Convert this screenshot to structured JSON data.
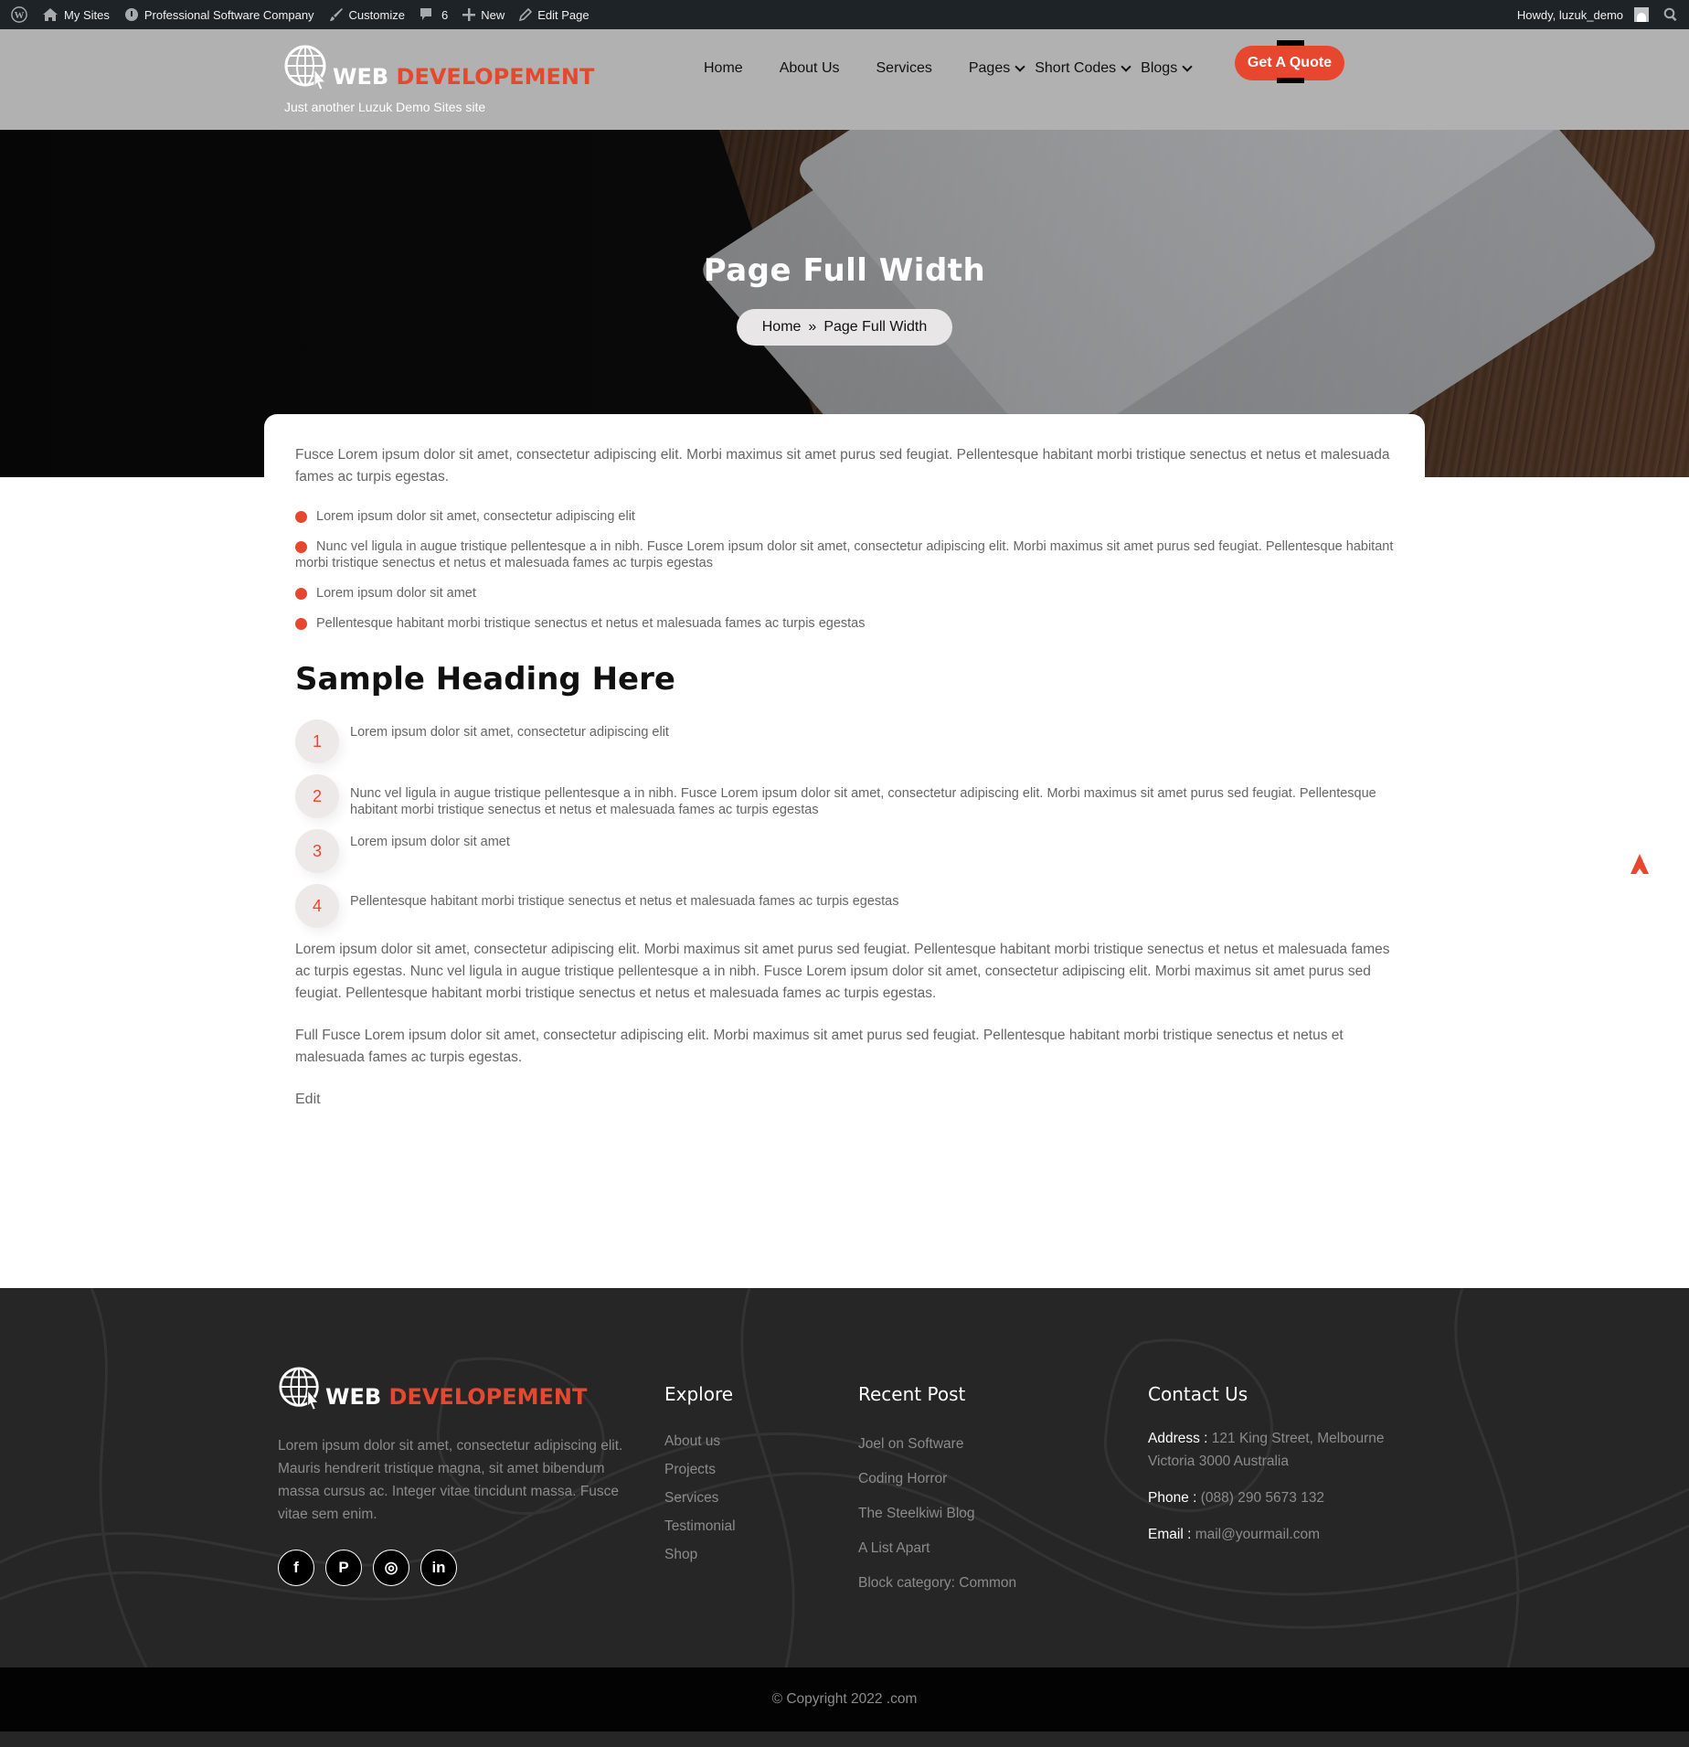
{
  "adminbar": {
    "my_sites": "My Sites",
    "site_name": "Professional Software Company",
    "customize": "Customize",
    "comments_count": "6",
    "new": "New",
    "edit_page": "Edit Page",
    "howdy": "Howdy, luzuk_demo"
  },
  "header": {
    "logo_word1": "WEB",
    "logo_word2": "DEVELOPEMENT",
    "tagline": "Just another Luzuk Demo Sites site",
    "nav": [
      {
        "label": "Home"
      },
      {
        "label": "About Us"
      },
      {
        "label": "Services"
      },
      {
        "label": "Pages"
      },
      {
        "label": "Short Codes"
      },
      {
        "label": "Blogs"
      }
    ],
    "cta": "Get A Quote"
  },
  "hero": {
    "title": "Page Full Width",
    "breadcrumb_home": "Home",
    "breadcrumb_sep": "»",
    "breadcrumb_current": "Page Full Width"
  },
  "content": {
    "intro": "Fusce Lorem ipsum dolor sit amet, consectetur adipiscing elit. Morbi maximus sit amet purus sed feugiat. Pellentesque habitant morbi tristique senectus et netus et malesuada fames ac turpis egestas.",
    "bullets": [
      "Lorem ipsum dolor sit amet, consectetur adipiscing elit",
      "Nunc vel ligula in augue tristique pellentesque a in nibh. Fusce Lorem ipsum dolor sit amet, consectetur adipiscing elit. Morbi maximus sit amet purus sed feugiat. Pellentesque habitant morbi tristique senectus et netus et malesuada fames ac turpis egestas",
      "Lorem ipsum dolor sit amet",
      "Pellentesque habitant morbi tristique senectus et netus et malesuada fames ac turpis egestas"
    ],
    "heading": "Sample Heading Here",
    "numbered": [
      {
        "num": "1",
        "text": "Lorem ipsum dolor sit amet, consectetur adipiscing elit"
      },
      {
        "num": "2",
        "text": "Nunc vel ligula in augue tristique pellentesque a in nibh. Fusce Lorem ipsum dolor sit amet, consectetur adipiscing elit. Morbi maximus sit amet purus sed feugiat. Pellentesque habitant morbi tristique senectus et netus et malesuada fames ac turpis egestas"
      },
      {
        "num": "3",
        "text": "Lorem ipsum dolor sit amet"
      },
      {
        "num": "4",
        "text": "Pellentesque habitant morbi tristique senectus et netus et malesuada fames ac turpis egestas"
      }
    ],
    "para1": "Lorem ipsum dolor sit amet, consectetur adipiscing elit. Morbi maximus sit amet purus sed feugiat. Pellentesque habitant morbi tristique senectus et netus et malesuada fames ac turpis egestas. Nunc vel ligula in augue tristique pellentesque a in nibh. Fusce Lorem ipsum dolor sit amet, consectetur adipiscing elit. Morbi maximus sit amet purus sed feugiat. Pellentesque habitant morbi tristique senectus et netus et malesuada fames ac turpis egestas.",
    "para2": "Full Fusce Lorem ipsum dolor sit amet, consectetur adipiscing elit. Morbi maximus sit amet purus sed feugiat. Pellentesque habitant morbi tristique senectus et netus et malesuada fames ac turpis egestas.",
    "edit": "Edit"
  },
  "footer": {
    "logo_word1": "WEB",
    "logo_word2": "DEVELOPEMENT",
    "description": "Lorem ipsum dolor sit amet, consectetur adipiscing elit. Mauris hendrerit tristique magna, sit amet bibendum massa cursus ac. Integer vitae tincidunt massa. Fusce vitae sem enim.",
    "socials": [
      {
        "icon": "facebook-icon",
        "glyph": "f"
      },
      {
        "icon": "pinterest-icon",
        "glyph": "P"
      },
      {
        "icon": "instagram-icon",
        "glyph": "◎"
      },
      {
        "icon": "linkedin-icon",
        "glyph": "in"
      }
    ],
    "explore": {
      "title": "Explore",
      "links": [
        "About us",
        "Projects",
        "Services",
        "Testimonial",
        "Shop"
      ]
    },
    "recent": {
      "title": "Recent Post",
      "links": [
        "Joel on Software",
        "Coding Horror",
        "The Steelkiwi Blog",
        "A List Apart",
        "Block category: Common"
      ]
    },
    "contact": {
      "title": "Contact Us",
      "address_label": "Address :",
      "address": "121 King Street, Melbourne Victoria 3000 Australia",
      "phone_label": "Phone :",
      "phone": "(088) 290 5673 132",
      "email_label": "Email :",
      "email": "mail@yourmail.com"
    },
    "copyright": "© Copyright 2022 .com"
  },
  "colors": {
    "accent": "#e8472f",
    "adminbar": "#1d2327",
    "header_bg": "#b1b1b1",
    "footer_bg": "#262626",
    "copyright_bg": "#030303"
  }
}
